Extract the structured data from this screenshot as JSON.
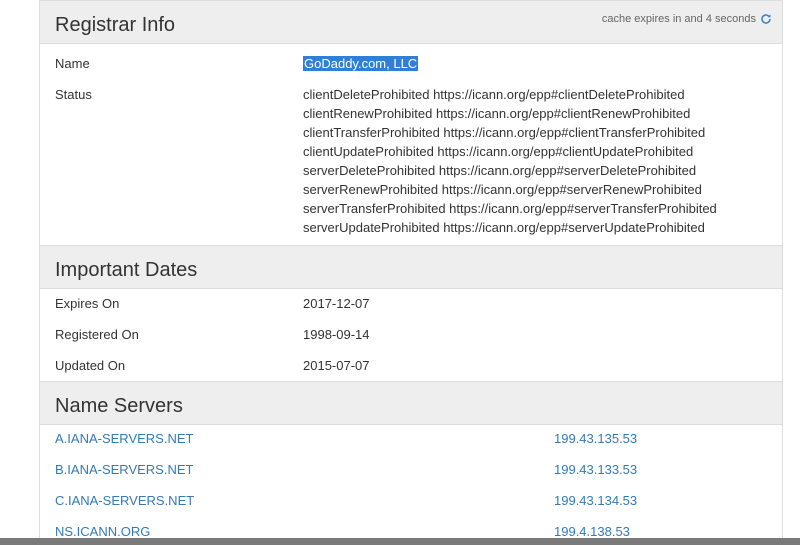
{
  "registrar_info": {
    "title": "Registrar Info",
    "cache_note": "cache expires in and 4 seconds",
    "name_label": "Name",
    "name_value": "GoDaddy.com, LLC",
    "status_label": "Status",
    "status_lines": [
      "clientDeleteProhibited https://icann.org/epp#clientDeleteProhibited",
      "clientRenewProhibited https://icann.org/epp#clientRenewProhibited",
      "clientTransferProhibited https://icann.org/epp#clientTransferProhibited",
      "clientUpdateProhibited https://icann.org/epp#clientUpdateProhibited",
      "serverDeleteProhibited https://icann.org/epp#serverDeleteProhibited",
      "serverRenewProhibited https://icann.org/epp#serverRenewProhibited",
      "serverTransferProhibited https://icann.org/epp#serverTransferProhibited",
      "serverUpdateProhibited https://icann.org/epp#serverUpdateProhibited"
    ]
  },
  "important_dates": {
    "title": "Important Dates",
    "rows": [
      {
        "label": "Expires On",
        "value": "2017-12-07"
      },
      {
        "label": "Registered On",
        "value": "1998-09-14"
      },
      {
        "label": "Updated On",
        "value": "2015-07-07"
      }
    ]
  },
  "name_servers": {
    "title": "Name Servers",
    "rows": [
      {
        "host": "A.IANA-SERVERS.NET",
        "ip": "199.43.135.53"
      },
      {
        "host": "B.IANA-SERVERS.NET",
        "ip": "199.43.133.53"
      },
      {
        "host": "C.IANA-SERVERS.NET",
        "ip": "199.43.134.53"
      },
      {
        "host": "NS.ICANN.ORG",
        "ip": "199.4.138.53"
      }
    ]
  },
  "colors": {
    "link": "#337ab7",
    "header_bg": "#eeeeee",
    "selection": "#2f7fd6"
  },
  "icons": {
    "refresh": "refresh-icon"
  }
}
